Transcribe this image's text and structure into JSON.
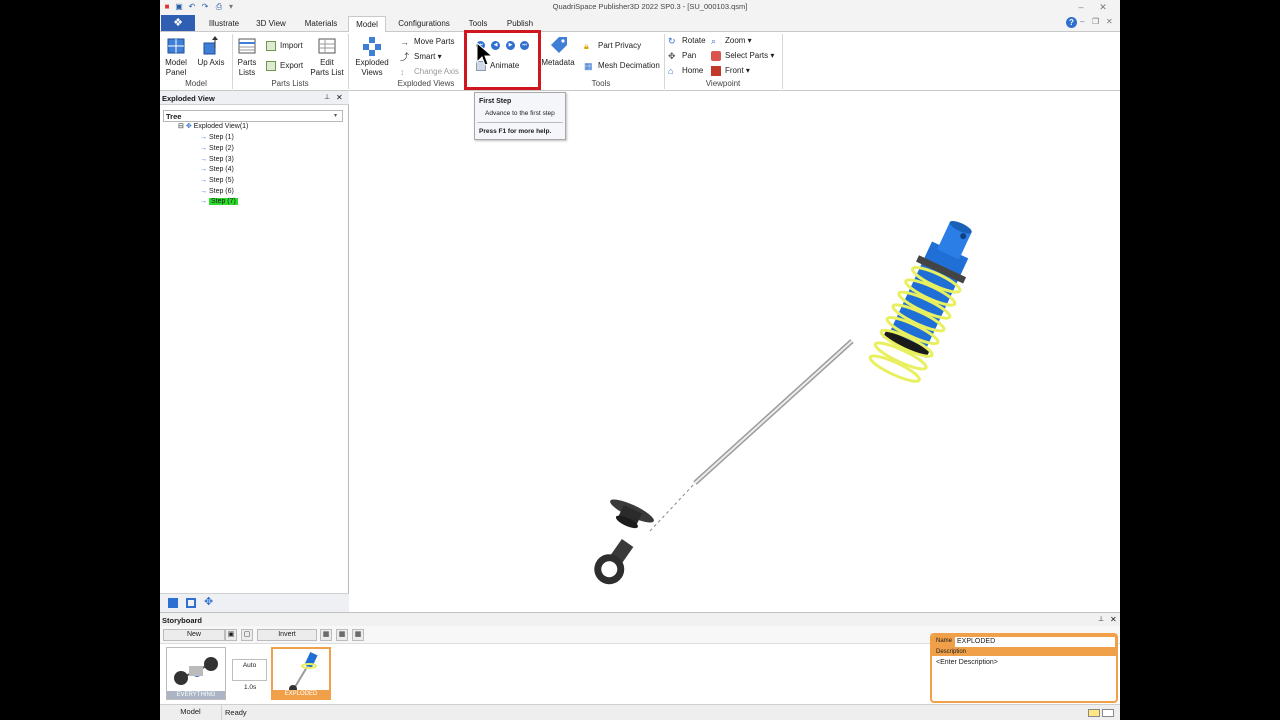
{
  "window": {
    "title": "QuadriSpace Publisher3D  2022 SP0.3 - [SU_000103.qsm]"
  },
  "tabs": [
    {
      "label": "Illustrate",
      "active": false
    },
    {
      "label": "3D View",
      "active": false
    },
    {
      "label": "Materials",
      "active": false
    },
    {
      "label": "Model",
      "active": true
    },
    {
      "label": "Configurations",
      "active": false
    },
    {
      "label": "Tools",
      "active": false
    },
    {
      "label": "Publish",
      "active": false
    }
  ],
  "ribbon": {
    "model_group": {
      "label": "Model",
      "model_panel": "Model Panel",
      "up_axis": "Up Axis"
    },
    "parts_lists_group": {
      "label": "Parts Lists",
      "parts_lists": "Parts Lists",
      "import": "Import",
      "export": "Export",
      "edit_parts_list": "Edit Parts List"
    },
    "exploded_views_group": {
      "label": "Exploded Views",
      "exploded_views": "Exploded Views",
      "move_parts": "Move Parts",
      "smart": "Smart",
      "change_axis": "Change Axis",
      "animate": "Animate"
    },
    "tools_group": {
      "label": "Tools",
      "metadata": "Metadata",
      "part_privacy": "Part Privacy",
      "mesh_decimation": "Mesh Decimation"
    },
    "viewpoint_group": {
      "label": "Viewpoint",
      "rotate": "Rotate",
      "pan": "Pan",
      "home": "Home",
      "zoom": "Zoom",
      "select_parts": "Select Parts",
      "front": "Front"
    }
  },
  "tooltip": {
    "title": "First Step",
    "description": "Advance to the first step",
    "help": "Press F1 for more help."
  },
  "left_pane": {
    "title": "Exploded View",
    "combo": "Tree",
    "root": "Exploded View(1)",
    "steps": [
      "Step (1)",
      "Step (2)",
      "Step (3)",
      "Step (4)",
      "Step (5)",
      "Step (6)",
      "Step (7)"
    ],
    "selected_step": 6
  },
  "storyboard": {
    "title": "Storyboard",
    "new_label": "New",
    "invert_label": "Invert",
    "items": [
      {
        "caption": "EVERYTHING"
      },
      {
        "caption": "EXPLODED"
      }
    ],
    "transition": {
      "mode": "Auto",
      "duration": "1.0s"
    },
    "properties": {
      "name_label": "Name",
      "name_value": "EXPLODED",
      "description_label": "Description",
      "description_placeholder": "<Enter Description>"
    }
  },
  "statusbar": {
    "tab_label": "Model",
    "status": "Ready"
  },
  "colors": {
    "accent_blue": "#2f5fb3",
    "highlight_red": "#d0161e",
    "selection_green": "#2ddb2d",
    "storyboard_orange": "#f1a04a",
    "part_blue": "#1f6fd6",
    "spring_yellow": "#e8f060"
  }
}
